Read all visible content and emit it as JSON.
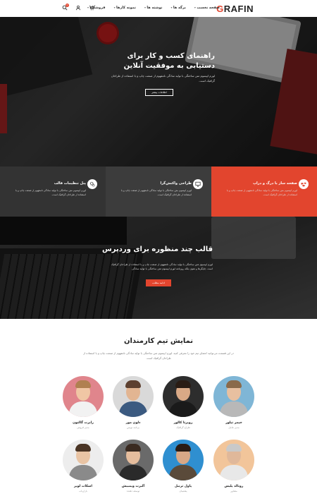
{
  "header": {
    "logo_first": "G",
    "logo_rest": "RAFIN",
    "nav": [
      "صفحه نخست",
      "برگه ها",
      "نوشته ها",
      "نمونه کارها",
      "فروشگاه"
    ],
    "icons": [
      "search-icon",
      "user-icon",
      "cart-icon"
    ],
    "cart_count": "0"
  },
  "hero": {
    "title_line1": "راهنمای کسب و کار برای",
    "title_line2": "دستیابی به موفقیت آنلاین",
    "text": "لورم ایپسوم متن ساختگی با تولید سادگی نامفهوم از صنعت چاپ و با استفاده از طراحان گرافیک است.",
    "button": "اطلاعات بیشتر"
  },
  "features": [
    {
      "title": "صفحه ساز با درگ و دراپ",
      "text": "لورم ایپسوم متن ساختگی با تولید سادگی نامفهوم از صنعت چاپ و با استفاده از طراحان گرافیک است.",
      "icon": "dropbox-icon"
    },
    {
      "title": "طراحی واکنش‌گرا",
      "text": "لورم ایپسوم متن ساختگی با تولید سادگی نامفهوم از صنعت چاپ و با استفاده از طراحان گرافیک است.",
      "icon": "monitor-icon"
    },
    {
      "title": "پنل تنظیمات قالب",
      "text": "لورم ایپسوم متن ساختگی با تولید سادگی نامفهوم از صنعت چاپ و با استفاده از طراحان گرافیک است.",
      "icon": "gears-icon"
    }
  ],
  "banner": {
    "title": "قالب چند منظوره برای وردپرس",
    "text": "لورم ایپسوم متن ساختگی با تولید سادگی نامفهوم از صنعت چاپ و با استفاده از طراحان گرافیک است. چاپگرها و متون بلکه روزنامه لورم ایپسوم متن ساختگی با تولید سادگی",
    "button": "ادامه مطلب"
  },
  "team": {
    "title": "نمایش تیم کارمندان",
    "text": "در این قسمت می‌توانید اعضای تیم خود را معرفی کنید. لورم ایپسوم متن ساختگی با تولید سادگی نامفهوم از صنعت چاپ و با استفاده از طراحان گرافیک است.",
    "members": [
      {
        "name": "جیمز تیلور",
        "role": "مدیر عامل",
        "bg": "#7fb6d6",
        "skin": "#e8c0a0",
        "hair": "#8a6a4a",
        "shirt": "#b8b8b8"
      },
      {
        "name": "روبرتا کالور",
        "role": "طراح گرافیک",
        "bg": "#2d2d2d",
        "skin": "#d9a986",
        "hair": "#2a1c14",
        "shirt": "#1a1a1a"
      },
      {
        "name": "دلون مور",
        "role": "برنامه نویس",
        "bg": "#d9d9d9",
        "skin": "#e2b592",
        "hair": "#5d4030",
        "shirt": "#3b5a80"
      },
      {
        "name": "رابرت گالتون",
        "role": "مدیر فروش",
        "bg": "#e0858c",
        "skin": "#f0c6a4",
        "hair": "#b08050",
        "shirt": "#f2f2f2"
      },
      {
        "name": "رونالد پلیس",
        "role": "مشاور",
        "bg": "#f2c59a",
        "skin": "#e0b89a",
        "hair": "#c9c9c9",
        "shirt": "#e8e8e8"
      },
      {
        "name": "پاول ترنبل",
        "role": "پشتیبان",
        "bg": "#2f8fd0",
        "skin": "#d8a886",
        "hair": "#2a1c14",
        "shirt": "#5a4a3a"
      },
      {
        "name": "آلبرت ویمبیش",
        "role": "توسعه دهنده",
        "bg": "#6a6a6a",
        "skin": "#e6bd9d",
        "hair": "#3a2a20",
        "shirt": "#2a2a2a"
      },
      {
        "name": "اسکات لویز",
        "role": "بازاریاب",
        "bg": "#ededed",
        "skin": "#e9c4a4",
        "hair": "#4a3424",
        "shirt": "#8a8a8a"
      }
    ]
  }
}
